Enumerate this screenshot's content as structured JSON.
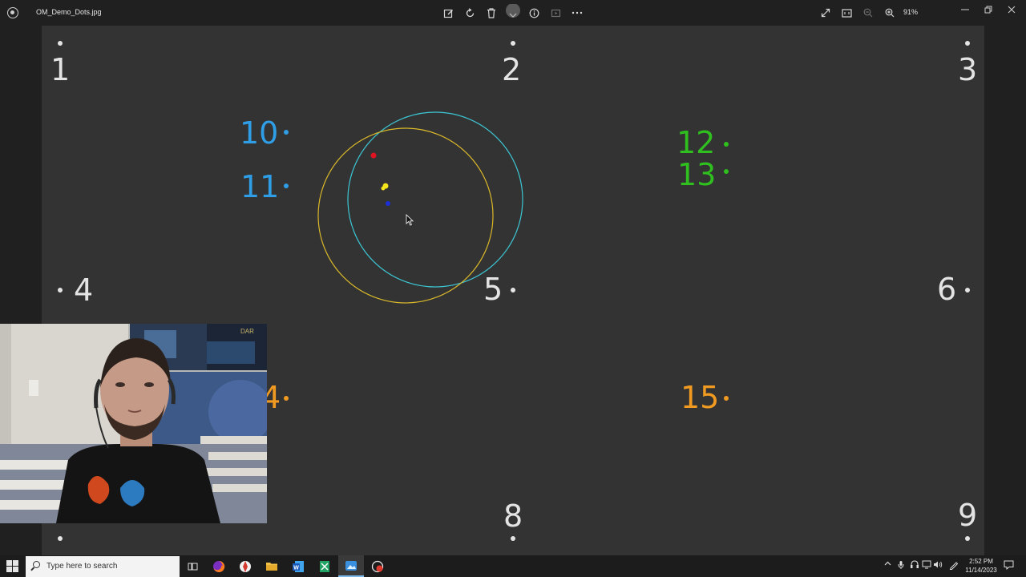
{
  "window": {
    "file_name": "OM_Demo_Dots.jpg",
    "zoom": "91%",
    "toolbar_icons": [
      "edit-icon",
      "rotate-icon",
      "delete-icon",
      "favorite-icon",
      "info-icon",
      "slideshow-icon",
      "more-icon"
    ],
    "right_icons": [
      "expand-icon",
      "actual-size-icon",
      "zoom-out-icon",
      "zoom-in-icon"
    ],
    "window_controls": [
      "minimize-icon",
      "maximize-icon",
      "close-icon"
    ]
  },
  "image": {
    "labels": [
      {
        "id": "1",
        "text": "1",
        "color": "white"
      },
      {
        "id": "2",
        "text": "2",
        "color": "white"
      },
      {
        "id": "3",
        "text": "3",
        "color": "white"
      },
      {
        "id": "4",
        "text": "4",
        "color": "white"
      },
      {
        "id": "5",
        "text": "5",
        "color": "white"
      },
      {
        "id": "6",
        "text": "6",
        "color": "white"
      },
      {
        "id": "8",
        "text": "8",
        "color": "white"
      },
      {
        "id": "9",
        "text": "9",
        "color": "white"
      },
      {
        "id": "10",
        "text": "10",
        "color": "blue"
      },
      {
        "id": "11",
        "text": "11",
        "color": "blue"
      },
      {
        "id": "12",
        "text": "12",
        "color": "green"
      },
      {
        "id": "13",
        "text": "13",
        "color": "green"
      },
      {
        "id": "14",
        "text": "4",
        "color": "orange"
      },
      {
        "id": "15",
        "text": "15",
        "color": "orange"
      }
    ],
    "colors": {
      "white": "#e4e4e4",
      "blue": "#2f9ee6",
      "green": "#2fbf1f",
      "orange": "#f09a22",
      "cyan_circle": "#3cc6d4",
      "yellow_circle": "#d9b82a",
      "red_marker": "#e0141e",
      "blue_marker": "#1a2fd8",
      "yellow_marker": "#f5e51b"
    }
  },
  "taskbar": {
    "search_placeholder": "Type here to search",
    "apps": [
      "task-view-icon",
      "firefox-icon",
      "app-icon",
      "file-explorer-icon",
      "word-icon",
      "excel-icon",
      "active-app-icon",
      "app2-icon"
    ],
    "time": "2:52 PM",
    "date": "11/14/2023"
  }
}
